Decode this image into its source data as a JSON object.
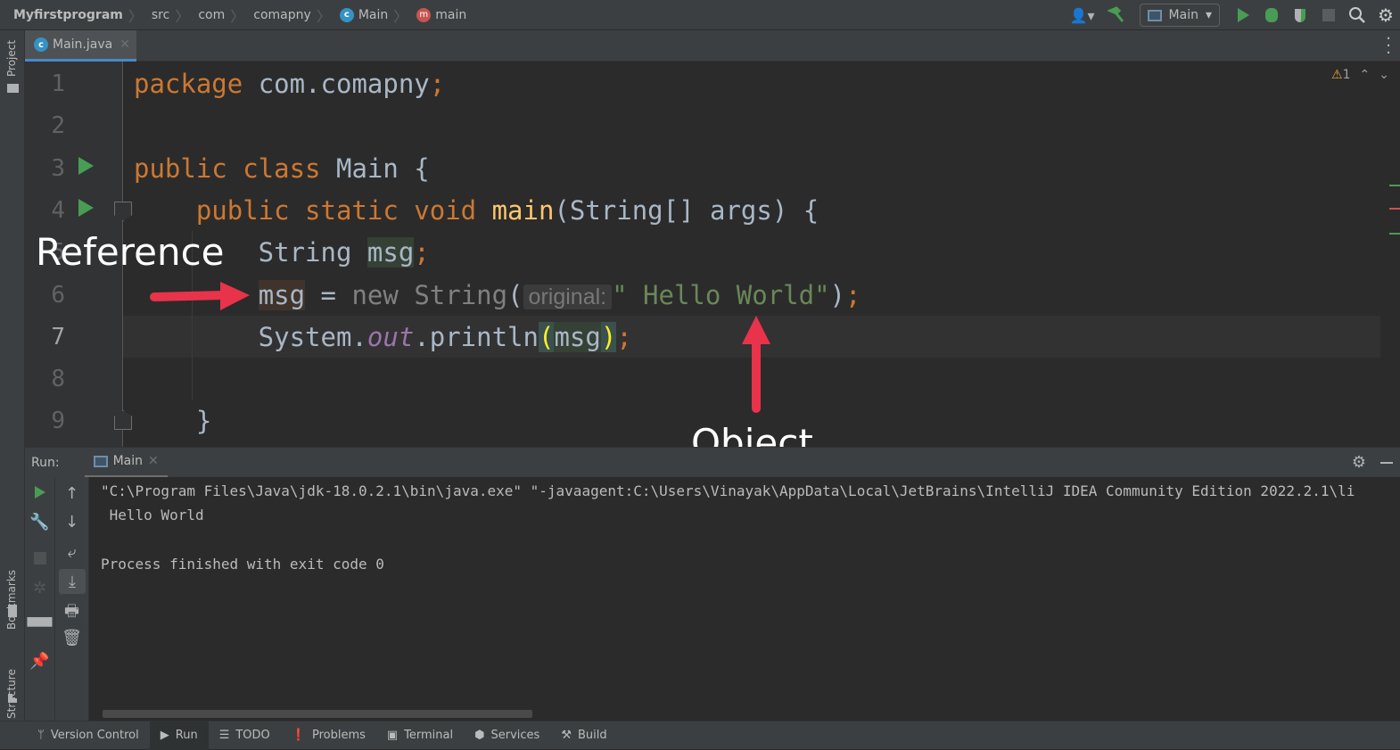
{
  "breadcrumb": [
    "Myfirstprogram",
    "src",
    "com",
    "comapny",
    "Main",
    "main"
  ],
  "toolbar": {
    "run_config": "Main"
  },
  "sidebar": {
    "project": "Project",
    "bookmarks": "Bookmarks",
    "structure": "Structure"
  },
  "editor": {
    "tab": "Main.java",
    "warnings": "1",
    "line_numbers": [
      "1",
      "2",
      "3",
      "4",
      "5",
      "6",
      "7",
      "8",
      "9"
    ],
    "current_line": "7",
    "lines": [
      [
        {
          "t": "package ",
          "k": "kw"
        },
        {
          "t": "com.comapny",
          "k": ""
        },
        {
          "t": ";",
          "k": "kw"
        }
      ],
      [],
      [
        {
          "t": "public class ",
          "k": "kw"
        },
        {
          "t": "Main {",
          "k": ""
        }
      ],
      [
        {
          "t": "    public static void ",
          "k": "kw"
        },
        {
          "t": "main",
          "k": "meth"
        },
        {
          "t": "(String[] args) {",
          "k": ""
        }
      ],
      [
        {
          "t": "        String ",
          "k": ""
        },
        {
          "t": "msg",
          "k": "hlvar"
        },
        {
          "t": ";",
          "k": "kw"
        }
      ],
      [
        {
          "t": "        ",
          "k": ""
        },
        {
          "t": "msg",
          "k": "hlref"
        },
        {
          "t": " = ",
          "k": ""
        },
        {
          "t": "new ",
          "k": "dim"
        },
        {
          "t": "String",
          "k": "dim"
        },
        {
          "t": "(",
          "k": ""
        },
        {
          "t": "original:",
          "k": "hint"
        },
        {
          "t": "\" Hello World\"",
          "k": "str"
        },
        {
          "t": ")",
          "k": ""
        },
        {
          "t": ";",
          "k": "kw"
        }
      ],
      [
        {
          "t": "        System.",
          "k": ""
        },
        {
          "t": "out",
          "k": "fld"
        },
        {
          "t": ".println",
          "k": ""
        },
        {
          "t": "(",
          "k": "brace"
        },
        {
          "t": "msg",
          "k": "hlvar"
        },
        {
          "t": ")",
          "k": "brace"
        },
        {
          "t": ";",
          "k": "kw"
        }
      ],
      [],
      [
        {
          "t": "    }",
          "k": ""
        }
      ]
    ]
  },
  "annotations": {
    "reference": "Reference",
    "object": "Object",
    "arrow_color": "#e8334a"
  },
  "run": {
    "label": "Run:",
    "tab": "Main",
    "output": [
      "\"C:\\Program Files\\Java\\jdk-18.0.2.1\\bin\\java.exe\" \"-javaagent:C:\\Users\\Vinayak\\AppData\\Local\\JetBrains\\IntelliJ IDEA Community Edition 2022.2.1\\li",
      " Hello World",
      "",
      "Process finished with exit code 0"
    ]
  },
  "statusbar": [
    "Version Control",
    "Run",
    "TODO",
    "Problems",
    "Terminal",
    "Services",
    "Build"
  ],
  "colors": {
    "keyword": "#cc7832",
    "string": "#6a8759",
    "method": "#ffc66d",
    "field": "#9876aa",
    "run_green": "#499c54",
    "accent": "#4a88c7"
  }
}
